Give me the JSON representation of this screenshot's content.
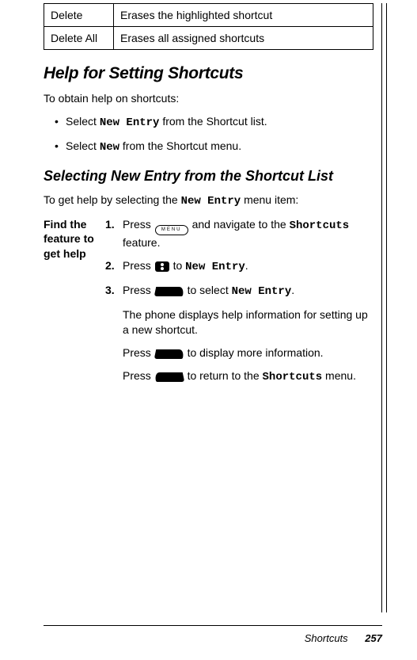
{
  "table": {
    "rows": [
      {
        "name": "Delete",
        "desc": "Erases the highlighted shortcut"
      },
      {
        "name": "Delete All",
        "desc": "Erases all assigned shortcuts"
      }
    ]
  },
  "heading1": "Help for Setting Shortcuts",
  "intro1": "To obtain help on shortcuts:",
  "bullets": {
    "b1a": "Select ",
    "b1b": "New Entry",
    "b1c": " from the Shortcut list.",
    "b2a": "Select ",
    "b2b": "New",
    "b2c": " from the Shortcut menu."
  },
  "heading2": "Selecting New Entry from the Shortcut List",
  "intro2a": "To get help by selecting the ",
  "intro2b": "New Entry",
  "intro2c": "  menu item:",
  "sidebar_label": "Find the feature to get help",
  "steps": {
    "s1": {
      "num": "1.",
      "a": "Press ",
      "b": " and navigate to the ",
      "c": "Shortcuts",
      "d": " feature."
    },
    "s2": {
      "num": "2.",
      "a": "Press ",
      "b": " to ",
      "c": "New Entry",
      "d": "."
    },
    "s3": {
      "num": "3.",
      "a": "Press ",
      "b": " to select ",
      "c": "New Entry",
      "d": "."
    },
    "cont1": "The phone displays help information for setting up a new shortcut.",
    "cont2a": "Press ",
    "cont2b": " to display more information.",
    "cont3a": "Press ",
    "cont3b": " to return to the ",
    "cont3c": "Shortcuts",
    "cont3d": " menu."
  },
  "footer": {
    "label": "Shortcuts",
    "page": "257"
  },
  "icons": {
    "menu_label": "MENU"
  }
}
